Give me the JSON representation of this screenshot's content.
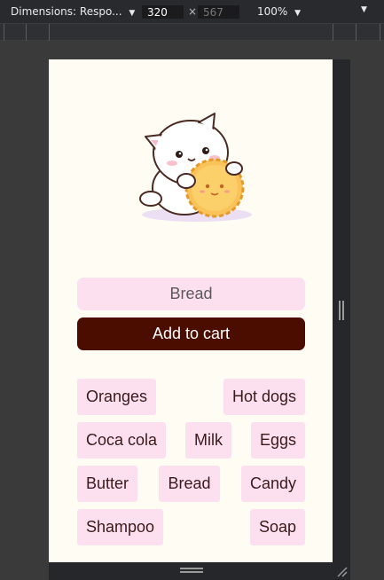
{
  "devtools": {
    "dimensions_label": "Dimensions: Respo...",
    "width": "320",
    "height": "567",
    "times": "×",
    "zoom": "100%"
  },
  "app": {
    "input_value": "Bread",
    "add_button": "Add to cart",
    "rows": [
      [
        "Oranges",
        "Hot dogs"
      ],
      [
        "Coca cola",
        "Milk",
        "Eggs"
      ],
      [
        "Butter",
        "Bread",
        "Candy"
      ],
      [
        "Shampoo",
        "Soap"
      ]
    ]
  },
  "colors": {
    "page_bg": "#fffcf3",
    "chip_bg": "#fde0f0",
    "button_bg": "#4a0d00"
  }
}
